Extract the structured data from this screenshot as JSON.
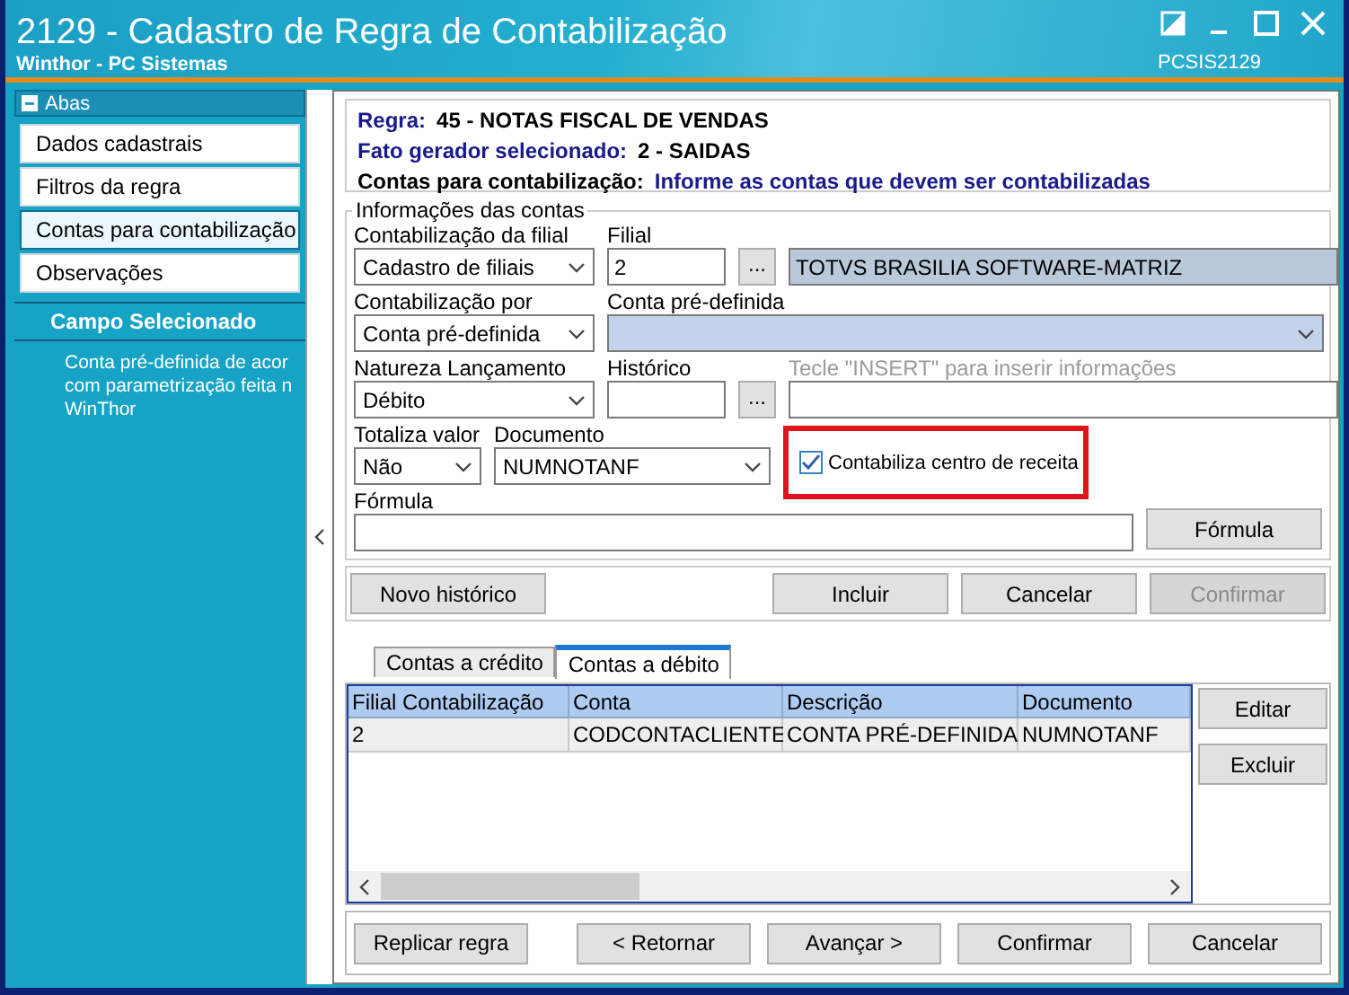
{
  "window": {
    "title": "2129 - Cadastro de Regra de Contabilização",
    "subtitle": "Winthor - PC Sistemas",
    "code": "PCSIS2129"
  },
  "sidebar": {
    "header": "Abas",
    "items": [
      {
        "label": "Dados cadastrais",
        "selected": false
      },
      {
        "label": "Filtros da regra",
        "selected": false
      },
      {
        "label": "Contas para contabilização",
        "selected": true
      },
      {
        "label": "Observações",
        "selected": false
      }
    ],
    "section_title": "Campo Selecionado",
    "description": [
      "Conta pré-definida de acor",
      "com parametrização feita n",
      "WinThor"
    ]
  },
  "info": {
    "rule": {
      "label": "Regra:",
      "value": "45 - NOTAS FISCAL DE VENDAS"
    },
    "trigger": {
      "label": "Fato gerador selecionado:",
      "value": "2 - SAIDAS"
    },
    "accounts": {
      "label": "Contas para contabilização:",
      "value": "Informe as contas que devem ser contabilizadas"
    }
  },
  "form": {
    "legend": "Informações das contas",
    "contabilizacao_filial": {
      "label": "Contabilização da filial",
      "value": "Cadastro de filiais"
    },
    "filial": {
      "label": "Filial",
      "value": "2",
      "button": "...",
      "name": "TOTVS BRASILIA SOFTWARE-MATRIZ"
    },
    "contabilizacao_por": {
      "label": "Contabilização por",
      "value": "Conta pré-definida"
    },
    "conta_predefinida": {
      "label": "Conta pré-definida"
    },
    "natureza": {
      "label": "Natureza Lançamento",
      "value": "Débito"
    },
    "historico": {
      "label": "Histórico",
      "button": "...",
      "hint": "Tecle  \"INSERT\" para inserir informações"
    },
    "totaliza": {
      "label": "Totaliza valor",
      "value": "Não"
    },
    "documento": {
      "label": "Documento",
      "value": "NUMNOTANF"
    },
    "centro_receita": {
      "label": "Contabiliza centro de receita",
      "checked": true,
      "highlighted": true
    },
    "formula": {
      "label": "Fórmula",
      "button": "Fórmula"
    }
  },
  "actions": [
    {
      "label": "Novo histórico",
      "disabled": false
    },
    {
      "label": "Incluir",
      "disabled": false
    },
    {
      "label": "Cancelar",
      "disabled": false
    },
    {
      "label": "Confirmar",
      "disabled": true
    }
  ],
  "tabs": [
    {
      "label": "Contas a crédito",
      "selected": false
    },
    {
      "label": "Contas a débito",
      "selected": true
    }
  ],
  "table": {
    "columns": [
      "Filial Contabilização",
      "Conta",
      "Descrição",
      "Documento"
    ],
    "rows": [
      [
        "2",
        "CODCONTACLIENTE",
        "CONTA PRÉ-DEFINIDA",
        "NUMNOTANF"
      ]
    ]
  },
  "side_buttons": [
    "Editar",
    "Excluir"
  ],
  "footer_buttons": [
    "Replicar regra",
    "< Retornar",
    "Avançar >",
    "Confirmar",
    "Cancelar"
  ]
}
